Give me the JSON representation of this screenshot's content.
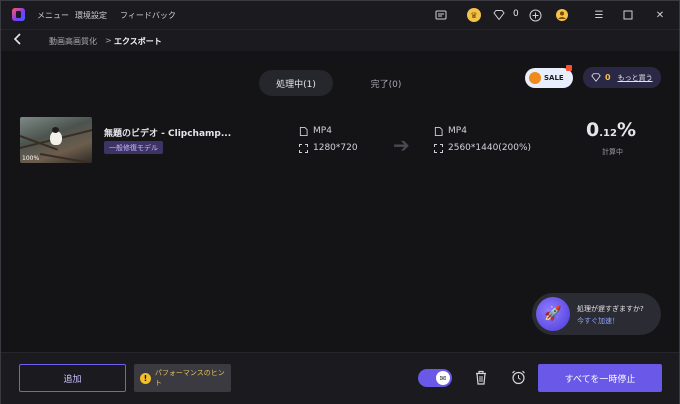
{
  "menu": {
    "items": [
      "メニュー",
      "環境設定",
      "フィードバック"
    ]
  },
  "titlebar": {
    "gem_count": "0"
  },
  "breadcrumb": {
    "parent": "動画高画質化",
    "separator": ">",
    "current": "エクスポート"
  },
  "tabs": [
    {
      "label": "処理中(1)",
      "active": true
    },
    {
      "label": "完了(0)",
      "active": false
    }
  ],
  "promo": {
    "sale_label": "SALE",
    "gem_count": "0",
    "buy_more": "もっと買う"
  },
  "task": {
    "thumbnail_label": "100%",
    "title": "無題のビデオ ‐ Clipchamp...",
    "model": "一般修復モデル",
    "source": {
      "format": "MP4",
      "resolution": "1280*720"
    },
    "target": {
      "format": "MP4",
      "resolution": "2560*1440(200%)"
    },
    "progress_int": "0",
    "progress_dec": ".12",
    "progress_unit": "%",
    "status": "計算中"
  },
  "speedup": {
    "question": "処理が遅すぎますか?",
    "link": "今すぐ加速！"
  },
  "footer": {
    "add_label": "追加",
    "hint_label": "パフォーマンスのヒント",
    "pause_all_label": "すべてを一時停止"
  },
  "colors": {
    "accent": "#6a58e8",
    "badge": "#3d3465",
    "gold": "#f3c24a"
  }
}
